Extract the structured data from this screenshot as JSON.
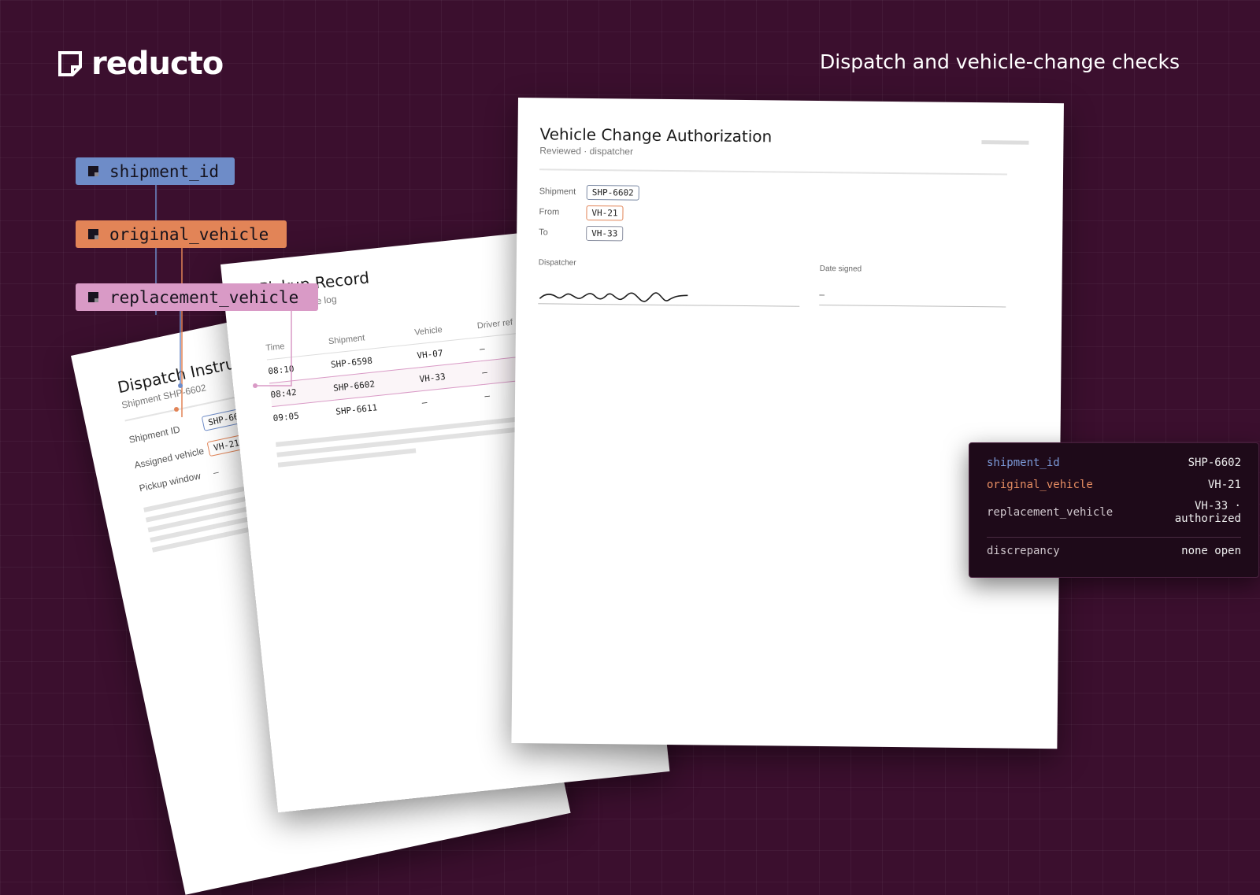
{
  "brand": {
    "name": "reducto",
    "logo_icon": "document-corner-icon"
  },
  "headline": "Dispatch and vehicle-change checks",
  "tags": [
    {
      "label": "shipment_id",
      "color": "#6e8cc8"
    },
    {
      "label": "original_vehicle",
      "color": "#e28457"
    },
    {
      "label": "replacement_vehicle",
      "color": "#d99ac6"
    }
  ],
  "dispatch": {
    "title": "Dispatch Instruction",
    "subtitle": "Shipment SHP-6602",
    "rows": [
      {
        "label": "Shipment ID",
        "value": "SHP-6602"
      },
      {
        "label": "Assigned vehicle",
        "value": "VH-21"
      },
      {
        "label": "Pickup window",
        "value": "–"
      }
    ]
  },
  "pickup": {
    "title": "Pickup Record",
    "subtitle": "e log",
    "columns": [
      "Time",
      "Shipment",
      "Vehicle",
      "Driver ref"
    ],
    "rows": [
      [
        "08:10",
        "SHP-6598",
        "VH-07",
        "–"
      ],
      [
        "08:42",
        "SHP-6602",
        "VH-33",
        "–"
      ],
      [
        "09:05",
        "SHP-6611",
        "–",
        "–"
      ]
    ]
  },
  "authorization": {
    "title": "Vehicle Change Authorization",
    "subtitle": "Reviewed · dispatcher",
    "rows": [
      {
        "label": "Shipment",
        "value": "SHP-6602"
      },
      {
        "label": "From",
        "value": "VH-21"
      },
      {
        "label": "To",
        "value": "VH-33"
      }
    ],
    "dispatcher_label": "Dispatcher",
    "date_label": "Date signed",
    "date_value": "–"
  },
  "result": {
    "rows": [
      {
        "key": "shipment_id",
        "value": "SHP-6602"
      },
      {
        "key": "original_vehicle",
        "value": "VH-21"
      },
      {
        "key": "replacement_vehicle",
        "value": "VH-33 · authorized"
      },
      {
        "key": "discrepancy",
        "value": "none open"
      }
    ]
  }
}
